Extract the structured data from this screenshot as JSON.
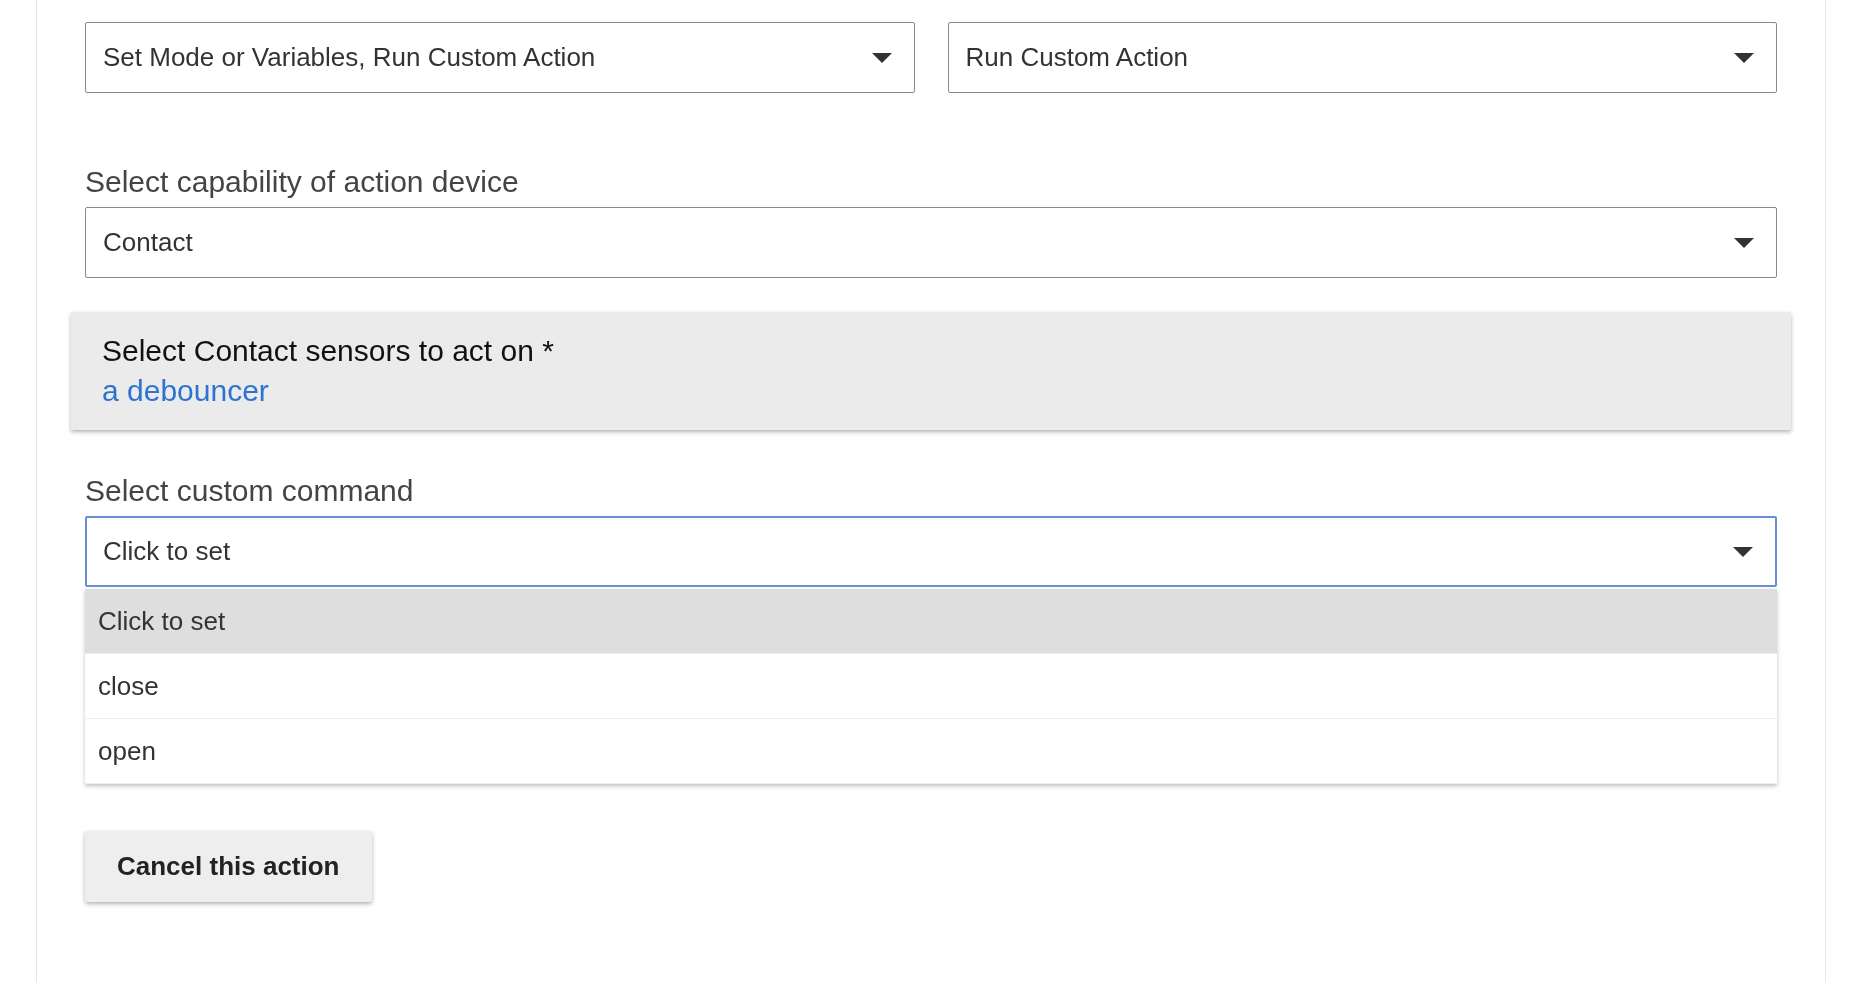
{
  "top_selects": [
    {
      "value": "Set Mode or Variables, Run Custom Action"
    },
    {
      "value": "Run Custom Action"
    }
  ],
  "capability": {
    "label": "Select capability of action device",
    "value": "Contact"
  },
  "device_card": {
    "title": "Select Contact sensors to act on *",
    "link": "a debouncer"
  },
  "command": {
    "label": "Select custom command",
    "value": "Click to set",
    "focused": true,
    "expanded": true,
    "options": [
      {
        "label": "Click to set",
        "selected": true
      },
      {
        "label": "close",
        "selected": false
      },
      {
        "label": "open",
        "selected": false
      }
    ]
  },
  "cancel_button": "Cancel this action"
}
